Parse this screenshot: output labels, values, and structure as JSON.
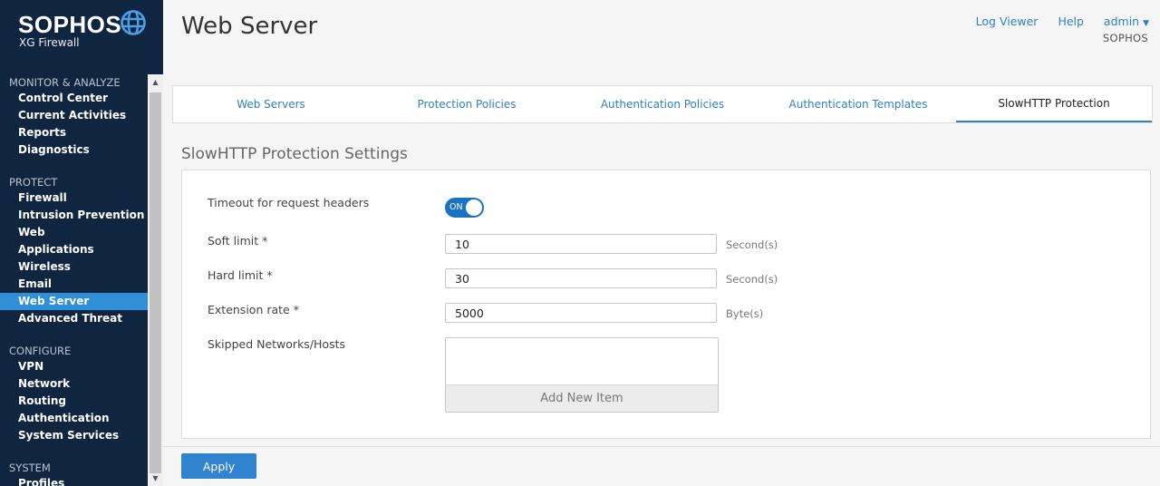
{
  "brand": {
    "name": "SOPHOS",
    "product": "XG Firewall",
    "logo_icon": "globe-icon"
  },
  "sidebar": {
    "sections": [
      {
        "title": "MONITOR & ANALYZE",
        "items": [
          "Control Center",
          "Current Activities",
          "Reports",
          "Diagnostics"
        ]
      },
      {
        "title": "PROTECT",
        "items": [
          "Firewall",
          "Intrusion Prevention",
          "Web",
          "Applications",
          "Wireless",
          "Email",
          "Web Server",
          "Advanced Threat"
        ]
      },
      {
        "title": "CONFIGURE",
        "items": [
          "VPN",
          "Network",
          "Routing",
          "Authentication",
          "System Services"
        ]
      },
      {
        "title": "SYSTEM",
        "items": [
          "Profiles"
        ]
      }
    ],
    "active_item": "Web Server"
  },
  "header": {
    "title": "Web Server",
    "links": {
      "log_viewer": "Log Viewer",
      "help": "Help",
      "admin": "admin"
    },
    "admin_org": "SOPHOS"
  },
  "tabs": [
    {
      "label": "Web Servers",
      "active": false
    },
    {
      "label": "Protection Policies",
      "active": false
    },
    {
      "label": "Authentication Policies",
      "active": false
    },
    {
      "label": "Authentication Templates",
      "active": false
    },
    {
      "label": "SlowHTTP Protection",
      "active": true
    }
  ],
  "settings": {
    "title": "SlowHTTP Protection Settings",
    "timeout": {
      "label": "Timeout for request headers",
      "toggle_text": "ON"
    },
    "soft_limit": {
      "label": "Soft limit *",
      "value": "10",
      "unit": "Second(s)"
    },
    "hard_limit": {
      "label": "Hard limit *",
      "value": "30",
      "unit": "Second(s)"
    },
    "extension_rate": {
      "label": "Extension rate *",
      "value": "5000",
      "unit": "Byte(s)"
    },
    "skipped": {
      "label": "Skipped Networks/Hosts",
      "add_label": "Add New Item"
    }
  },
  "footer": {
    "apply_label": "Apply"
  },
  "colors": {
    "sidebar_bg": "#10253f",
    "accent": "#2f83cf",
    "active_nav": "#2f8fd8",
    "link": "#2f7fc1"
  }
}
